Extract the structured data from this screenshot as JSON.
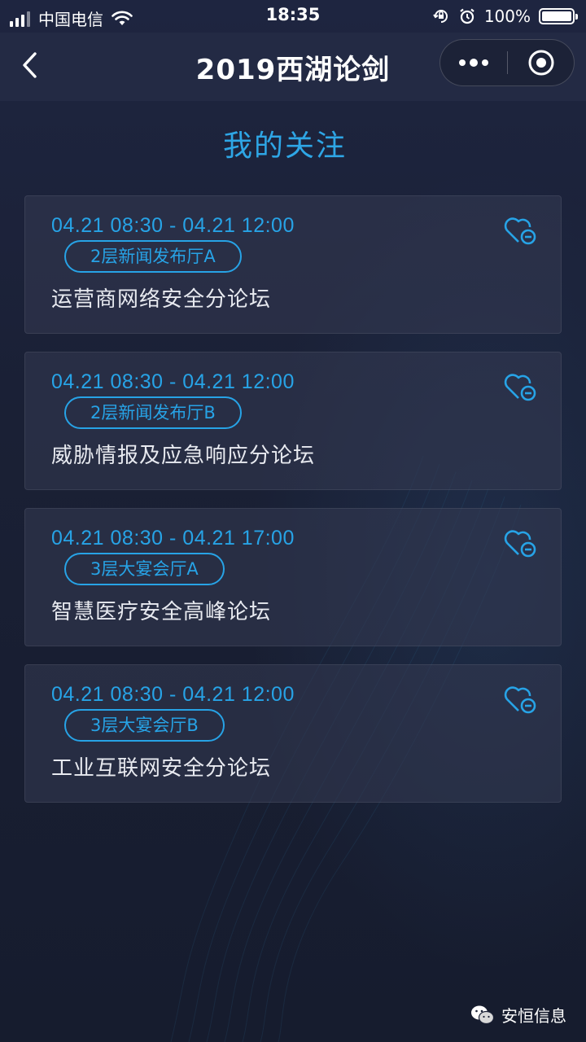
{
  "status_bar": {
    "carrier": "中国电信",
    "time": "18:35",
    "battery": "100%"
  },
  "nav": {
    "title": "2019西湖论剑"
  },
  "page": {
    "heading": "我的关注"
  },
  "sessions": [
    {
      "time": "04.21 08:30 - 04.21 12:00",
      "room": "2层新闻发布厅A",
      "title": "运营商网络安全分论坛"
    },
    {
      "time": "04.21 08:30 - 04.21 12:00",
      "room": "2层新闻发布厅B",
      "title": "威胁情报及应急响应分论坛"
    },
    {
      "time": "04.21 08:30 - 04.21 17:00",
      "room": "3层大宴会厅A",
      "title": "智慧医疗安全高峰论坛"
    },
    {
      "time": "04.21 08:30 - 04.21 12:00",
      "room": "3层大宴会厅B",
      "title": "工业互联网安全分论坛"
    }
  ],
  "watermark": {
    "text": "安恒信息"
  },
  "icons": {
    "unfollow": "heart-minus-icon",
    "back": "chevron-left-icon",
    "more": "more-dots-icon",
    "close": "target-close-icon",
    "wechat": "wechat-icon"
  },
  "colors": {
    "accent": "#27a3e6",
    "background": "#1b2238",
    "nav_background": "#232a44",
    "card_background": "#343a52"
  }
}
